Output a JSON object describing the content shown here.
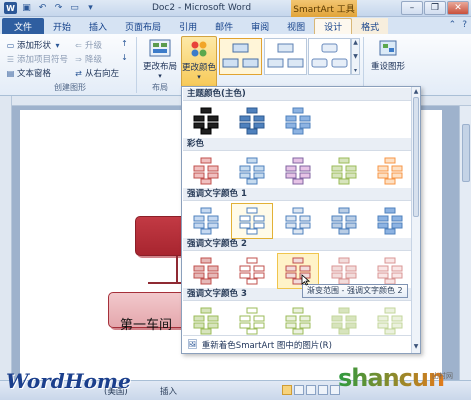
{
  "window": {
    "doc_title": "Doc2 - Microsoft Word",
    "context_title": "SmartArt 工具"
  },
  "tabs": {
    "file": "文件",
    "home": "开始",
    "insert": "插入",
    "page_layout": "页面布局",
    "references": "引用",
    "mailings": "邮件",
    "review": "审阅",
    "view": "视图",
    "design": "设计",
    "format": "格式"
  },
  "ribbon": {
    "add_shape": "添加形状",
    "add_bullet": "添加项目符号",
    "text_pane": "文本窗格",
    "promote": "升级",
    "demote": "降级",
    "right_to_left": "从右向左",
    "group_create": "创建图形",
    "change_layout": "更改布局",
    "group_layout": "布局",
    "change_colors": "更改颜色",
    "reset_graphic": "重设图形"
  },
  "document": {
    "node_text": "第一车间"
  },
  "dropdown": {
    "sections": [
      "主题颜色(主色)",
      "彩色",
      "强调文字颜色 1",
      "强调文字颜色 2",
      "强调文字颜色 3"
    ],
    "footer": "重新着色SmartArt 图中的图片(R)",
    "tooltip": "渐变范围 - 强调文字颜色 2"
  },
  "statusbar": {
    "language": "(美国)",
    "mode": "插入"
  },
  "watermarks": {
    "left": "WordHome",
    "right": "shancun",
    "right_sub": "山村网"
  },
  "colors": {
    "accent_file_tab": "#2f5ea0",
    "selection": "#e2b136",
    "red_accent": "#c0504d",
    "blue_accent": "#4f81bd",
    "green_accent": "#9bbb59"
  }
}
